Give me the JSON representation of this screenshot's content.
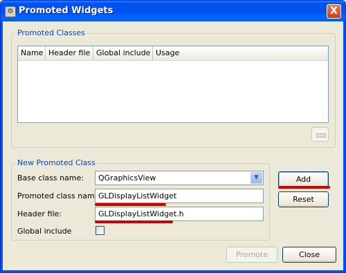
{
  "window": {
    "title": "Promoted Widgets",
    "close_symbol": "X"
  },
  "promoted_classes": {
    "legend": "Promoted Classes",
    "columns": [
      "Name",
      "Header file",
      "Global include",
      "Usage"
    ]
  },
  "new_class": {
    "legend": "New Promoted Class",
    "base_label": "Base class name:",
    "base_value": "QGraphicsView",
    "promoted_label": "Promoted class name:",
    "promoted_value": "GLDisplayListWidget",
    "header_label": "Header file:",
    "header_value": "GLDisplayListWidget.h",
    "global_label": "Global include",
    "global_checked": false
  },
  "buttons": {
    "add": "Add",
    "reset": "Reset",
    "promote": "Promote",
    "close": "Close"
  },
  "annotations": {
    "underline_color": "#d40000"
  },
  "icons": {
    "app": "designer-icon",
    "combo": "chevron-down-icon",
    "remove": "minus-icon"
  }
}
